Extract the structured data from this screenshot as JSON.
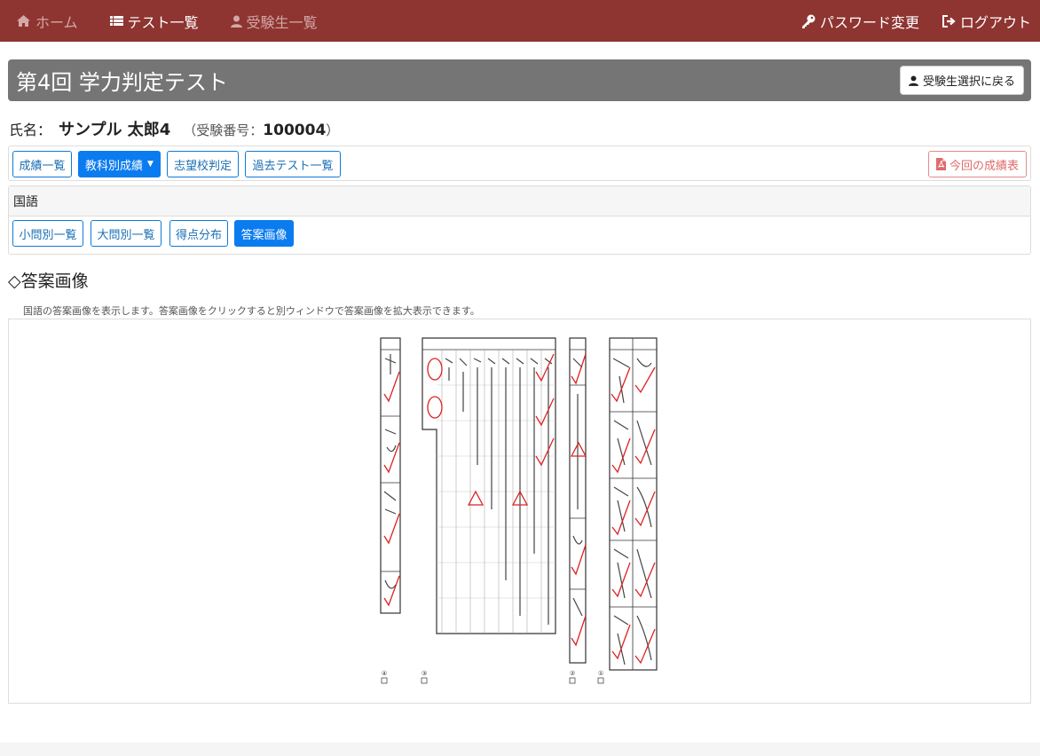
{
  "nav": {
    "home": "ホーム",
    "tests": "テスト一覧",
    "examinees": "受験生一覧",
    "password": "パスワード変更",
    "logout": "ログアウト"
  },
  "page": {
    "title": "第4回 学力判定テスト",
    "back_button": "受験生選択に戻る"
  },
  "student": {
    "name_label": "氏名：",
    "name": "サンプル 太郎4",
    "exam_open": "（受験番号：",
    "exam_number": "100004",
    "exam_close": "）"
  },
  "buttons": {
    "scores": "成績一覧",
    "subject_scores": "教科別成績",
    "school_judgement": "志望校判定",
    "past_tests": "過去テスト一覧",
    "report": "今回の成績表"
  },
  "subject": {
    "name": "国語",
    "tabs": [
      "小問別一覧",
      "大問別一覧",
      "得点分布",
      "答案画像"
    ]
  },
  "section": {
    "title": "◇答案画像",
    "description": "国語の答案画像を表示します。答案画像をクリックすると別ウィンドウで答案画像を拡大表示できます。"
  },
  "sheet_labels": [
    "④",
    "③",
    "②",
    "①"
  ],
  "colors": {
    "navbar": "#8e3431",
    "primary": "#0b7bf0",
    "danger": "#e06b6b",
    "title_bar": "#757575",
    "mark_red": "#d22"
  }
}
